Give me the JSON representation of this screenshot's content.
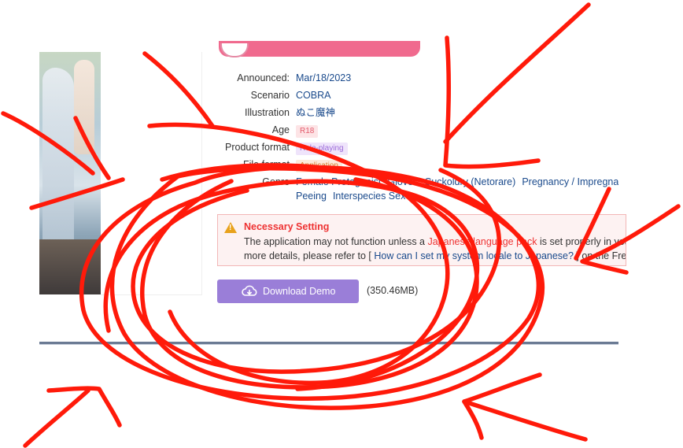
{
  "details": {
    "announced": {
      "label": "Announced:",
      "value": "Mar/18/2023"
    },
    "scenario": {
      "label": "Scenario",
      "value": "COBRA"
    },
    "illustration": {
      "label": "Illustration",
      "value": "ぬこ魔神"
    },
    "age": {
      "label": "Age",
      "value": "R18"
    },
    "product_format": {
      "label": "Product format",
      "value": "Role-playing"
    },
    "file_format": {
      "label": "File format",
      "value": "Application"
    },
    "genre": {
      "label": "Genre",
      "tags": [
        "Female Protagonist",
        "Gloves",
        "Cuckoldry (Netorare)",
        "Pregnancy / Impregnation",
        "Peeing",
        "Interspecies Sex"
      ]
    }
  },
  "notice": {
    "title": "Necessary Setting",
    "line1_pre": "The application may not function unless a ",
    "line1_link": "Japanese language pack",
    "line1_post": " is set properly in your",
    "line2_pre": "more details, please refer to [ ",
    "line2_link": "How can I set my system locale to Japanese?",
    "line2_post": " ] on the Freque"
  },
  "download": {
    "button_label": "Download Demo",
    "size": "(350.46MB)"
  },
  "colors": {
    "accent_pill": "#f06a8e",
    "download_button": "#9a7ed8",
    "link": "#1a4a8c",
    "scribble": "#ff1a0a"
  }
}
